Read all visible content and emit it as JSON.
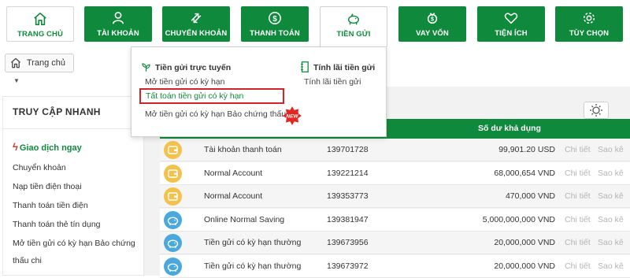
{
  "nav": {
    "items": [
      {
        "label": "TRANG CHỦ",
        "icon": "home-icon"
      },
      {
        "label": "TÀI KHOẢN",
        "icon": "user-icon"
      },
      {
        "label": "CHUYỂN KHOẢN",
        "icon": "transfer-icon"
      },
      {
        "label": "THANH TOÁN",
        "icon": "dollar-icon"
      },
      {
        "label": "TIỀN GỬI",
        "icon": "piggy-bank-icon"
      },
      {
        "label": "VAY VỐN",
        "icon": "loan-icon"
      },
      {
        "label": "TIỆN ÍCH",
        "icon": "heart-icon"
      },
      {
        "label": "TÙY CHỌN",
        "icon": "settings-icon"
      }
    ],
    "active": "TIỀN GỬI",
    "brand_color": "#0f8a3c"
  },
  "breadcrumb": {
    "label": "Trang chủ"
  },
  "sidebar": {
    "title": "TRUY CẬP NHANH",
    "section": "Giao dịch ngay",
    "items": [
      "Chuyển khoản",
      "Nạp tiền điện thoại",
      "Thanh toán tiền điện",
      "Thanh toán thẻ tín dụng",
      "Mở tiền gửi có kỳ hạn Bảo chứng",
      "thấu chi"
    ]
  },
  "dropdown": {
    "col1_title": "Tiền gửi trực tuyến",
    "col1_items": [
      "Mở tiền gửi có kỳ hạn",
      "Tất toán tiền gửi có kỳ hạn",
      "Mở tiền gửi có kỳ hạn Bảo chứng thấu chi"
    ],
    "new_badge": "NEW",
    "col2_title": "Tính lãi tiền gửi",
    "col2_items": [
      "Tính lãi tiền gửi"
    ],
    "highlight_color": "#d0232a"
  },
  "table": {
    "balance_header": "Số dư khả dụng",
    "rows": [
      {
        "icon": "wallet-icon",
        "name": "Tài khoản thanh toán",
        "number": "139701728",
        "balance": "99,901.20 USD",
        "detail": "Chi tiết",
        "statement": "Sao kê"
      },
      {
        "icon": "wallet-icon",
        "name": "Normal Account",
        "number": "139221214",
        "balance": "68,000,654 VND",
        "detail": "Chi tiết",
        "statement": "Sao kê"
      },
      {
        "icon": "wallet-icon",
        "name": "Normal Account",
        "number": "139353773",
        "balance": "470,000 VND",
        "detail": "Chi tiết",
        "statement": "Sao kê"
      },
      {
        "icon": "piggy-bank-icon",
        "name": "Online Normal Saving",
        "number": "139381947",
        "balance": "5,000,000,000 VND",
        "detail": "Chi tiết",
        "statement": "Sao kê"
      },
      {
        "icon": "piggy-bank-icon",
        "name": "Tiền gửi có kỳ hạn thường",
        "number": "139673956",
        "balance": "20,000,000 VND",
        "detail": "Chi tiết",
        "statement": "Sao kê"
      },
      {
        "icon": "piggy-bank-icon",
        "name": "Tiền gửi có kỳ hạn thường",
        "number": "139673972",
        "balance": "20,000,000 VND",
        "detail": "Chi tiết",
        "statement": "Sao kê"
      }
    ]
  }
}
